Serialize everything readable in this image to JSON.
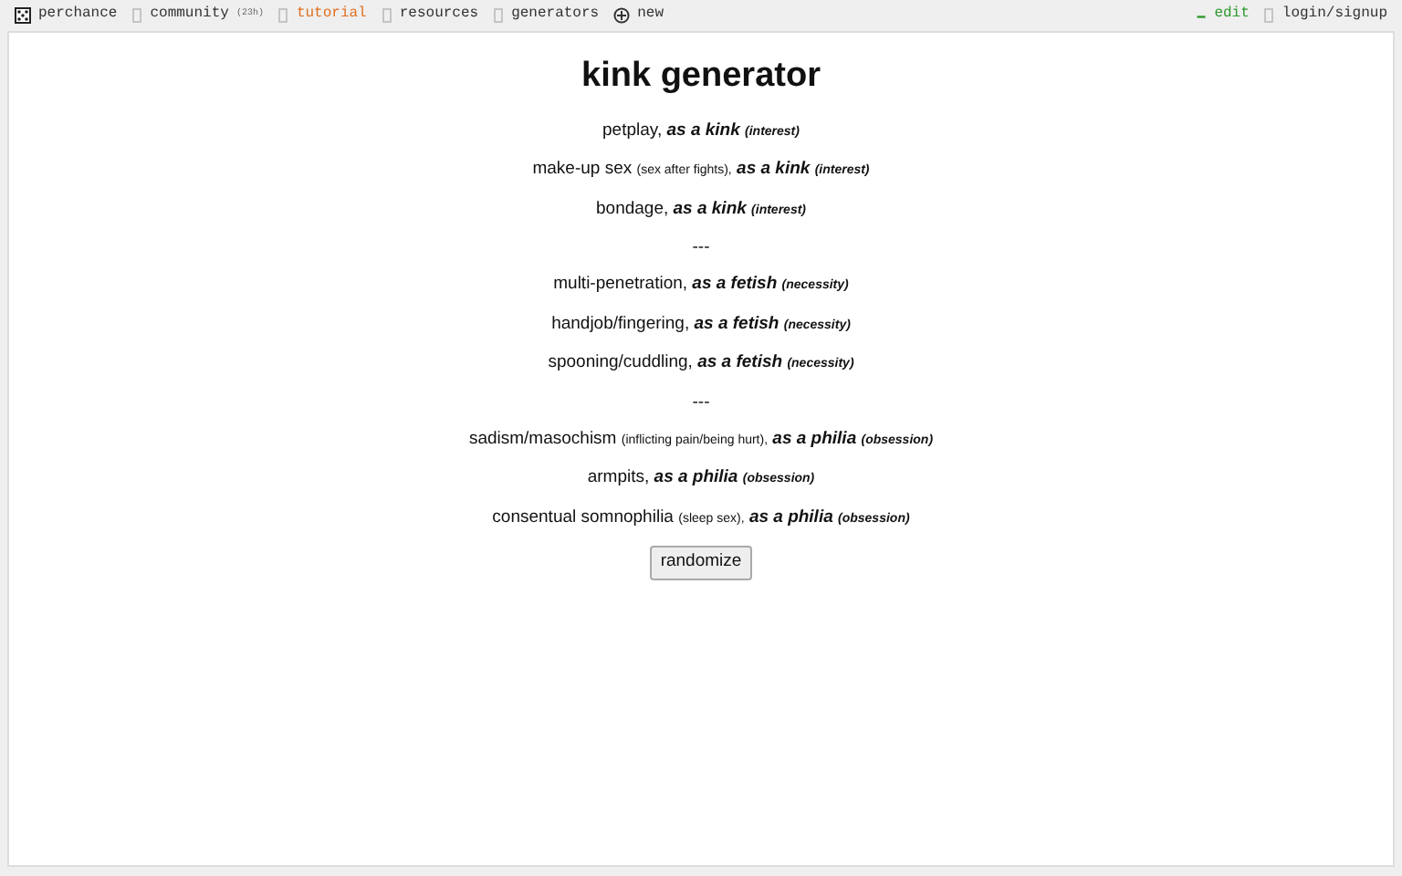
{
  "topbar": {
    "left": [
      {
        "label": "perchance"
      },
      {
        "label": "community",
        "count": "(23h)"
      },
      {
        "label": "tutorial",
        "color": "#e07020"
      },
      {
        "label": "resources"
      },
      {
        "label": "generators"
      },
      {
        "label": "new"
      }
    ],
    "right": [
      {
        "label": "edit",
        "color": "#2e9a2e"
      },
      {
        "label": "login/signup"
      }
    ]
  },
  "title": "kink generator",
  "lines": [
    {
      "kind": "result",
      "name": "petplay,",
      "type": "as a kink",
      "degree": "(interest)"
    },
    {
      "kind": "result",
      "name": "make-up sex",
      "note": "(sex after fights),",
      "type": "as a kink",
      "degree": "(interest)"
    },
    {
      "kind": "result",
      "name": "bondage,",
      "type": "as a kink",
      "degree": "(interest)"
    },
    {
      "kind": "separator",
      "text": "---"
    },
    {
      "kind": "result",
      "name": "multi-penetration,",
      "type": "as a fetish",
      "degree": "(necessity)"
    },
    {
      "kind": "result",
      "name": "handjob/fingering,",
      "type": "as a fetish",
      "degree": "(necessity)"
    },
    {
      "kind": "result",
      "name": "spooning/cuddling,",
      "type": "as a fetish",
      "degree": "(necessity)"
    },
    {
      "kind": "separator",
      "text": "---"
    },
    {
      "kind": "result",
      "name": "sadism/masochism",
      "note": "(inflicting pain/being hurt),",
      "type": "as a philia",
      "degree": "(obsession)"
    },
    {
      "kind": "result",
      "name": "armpits,",
      "type": "as a philia",
      "degree": "(obsession)"
    },
    {
      "kind": "result",
      "name": "consentual somnophilia",
      "note": "(sleep sex),",
      "type": "as a philia",
      "degree": "(obsession)"
    }
  ],
  "button": "randomize"
}
